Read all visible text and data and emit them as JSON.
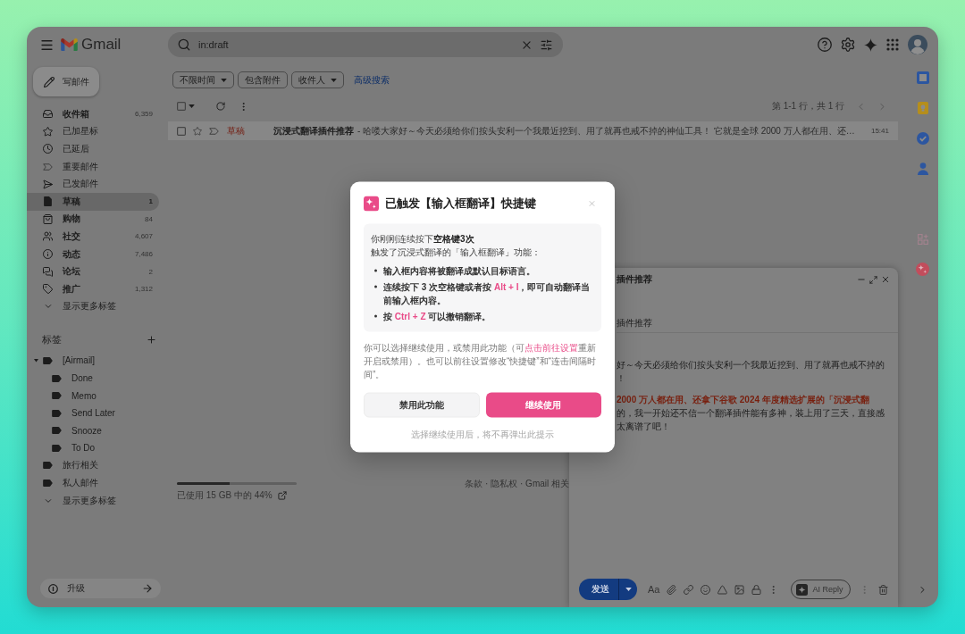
{
  "header": {
    "logo_text": "Gmail",
    "search": {
      "value": "in:draft"
    }
  },
  "compose_button": {
    "label": "写邮件"
  },
  "nav": [
    {
      "label": "收件箱",
      "count": "6,359",
      "unread": true,
      "selected": false
    },
    {
      "label": "已加星标",
      "unread": false,
      "selected": false
    },
    {
      "label": "已延后",
      "unread": false,
      "selected": false
    },
    {
      "label": "重要邮件",
      "unread": false,
      "selected": false
    },
    {
      "label": "已发邮件",
      "unread": false,
      "selected": false
    },
    {
      "label": "草稿",
      "count": "1",
      "unread": true,
      "selected": true
    },
    {
      "label": "购物",
      "count": "84",
      "unread": true,
      "selected": false
    },
    {
      "label": "社交",
      "count": "4,607",
      "unread": true,
      "selected": false
    },
    {
      "label": "动态",
      "count": "7,486",
      "unread": true,
      "selected": false
    },
    {
      "label": "论坛",
      "count": "2",
      "unread": true,
      "selected": false
    },
    {
      "label": "推广",
      "count": "1,312",
      "unread": true,
      "selected": false
    }
  ],
  "nav_more": "显示更多标签",
  "labels": {
    "title": "标签",
    "items": [
      {
        "label": "[Airmail]",
        "expanded": true,
        "children": [
          {
            "label": "Done"
          },
          {
            "label": "Memo"
          },
          {
            "label": "Send Later"
          },
          {
            "label": "Snooze"
          },
          {
            "label": "To Do"
          }
        ]
      },
      {
        "label": "旅行相关"
      },
      {
        "label": "私人邮件"
      }
    ],
    "more": "显示更多标签"
  },
  "upgrade": {
    "label": "升级"
  },
  "filters": [
    {
      "label": "不限时间",
      "dropdown": true
    },
    {
      "label": "包含附件",
      "dropdown": false
    },
    {
      "label": "收件人",
      "dropdown": true
    }
  ],
  "advanced_search": "高级搜索",
  "select_all": {
    "checked": false
  },
  "pagination": "第 1-1 行，共 1 行",
  "messages": [
    {
      "checked": false,
      "starred": false,
      "important": false,
      "sender": "草稿",
      "subject": "沉浸式翻译插件推荐",
      "snippet": "- 哈喽大家好～今天必须给你们按头安利一个我最近挖到、用了就再也戒不掉的神仙工具！ 它就是全球 2000 万人都在用、还…",
      "time": "15:41"
    }
  ],
  "storage": {
    "text": "已使用 15 GB 中的 44%",
    "level": 0.44
  },
  "footer": {
    "links": "条款 · 隐私权 · Gmail 相关"
  },
  "compose": {
    "title": "插件推荐",
    "subject": "插件推荐",
    "paragraphs": [
      {
        "lines": [
          {
            "text": "好～今天必须给你们按头安利一个我最近挖到、用了就再也戒不掉的",
            "highlight": false
          },
          {
            "text": "！",
            "highlight": false
          }
        ]
      },
      {
        "lines": [
          {
            "text": "2000 万人都在用、还拿下谷歌 2024 年度精选扩展的「沉浸式翻",
            "highlight": true
          },
          {
            "text": "的，我一开始还不信一个翻译插件能有多神，装上用了三天，直接感",
            "highlight": false
          },
          {
            "text": "太离谱了吧！",
            "highlight": false
          }
        ]
      }
    ],
    "send_label": "发送",
    "format_label": "Aa",
    "ai_reply_label": "AI Reply"
  },
  "dialog": {
    "title": "已触发【输入框翻译】快捷键",
    "intro": [
      "你刚刚连续按下**空格键3次**",
      "触发了沉浸式翻译的「输入框翻译」功能："
    ],
    "bullets": [
      "输入框内容将被翻译成默认目标语言。",
      "连续按下 3 次空格键或者按 **Alt + I**，即可自动翻译当前输入框内容。",
      "按 **Ctrl + Z** 可以撤销翻译。"
    ],
    "note": {
      "before": "你可以选择继续使用，或禁用此功能（可",
      "link": "点击前往设置",
      "after": "重新开启或禁用）。也可以前往设置修改“快捷键”和“连击间隔时间”。"
    },
    "buttons": [
      {
        "label": "禁用此功能",
        "primary": false
      },
      {
        "label": "继续使用",
        "primary": true
      }
    ],
    "hint": "选择继续使用后，将不再弹出此提示"
  }
}
